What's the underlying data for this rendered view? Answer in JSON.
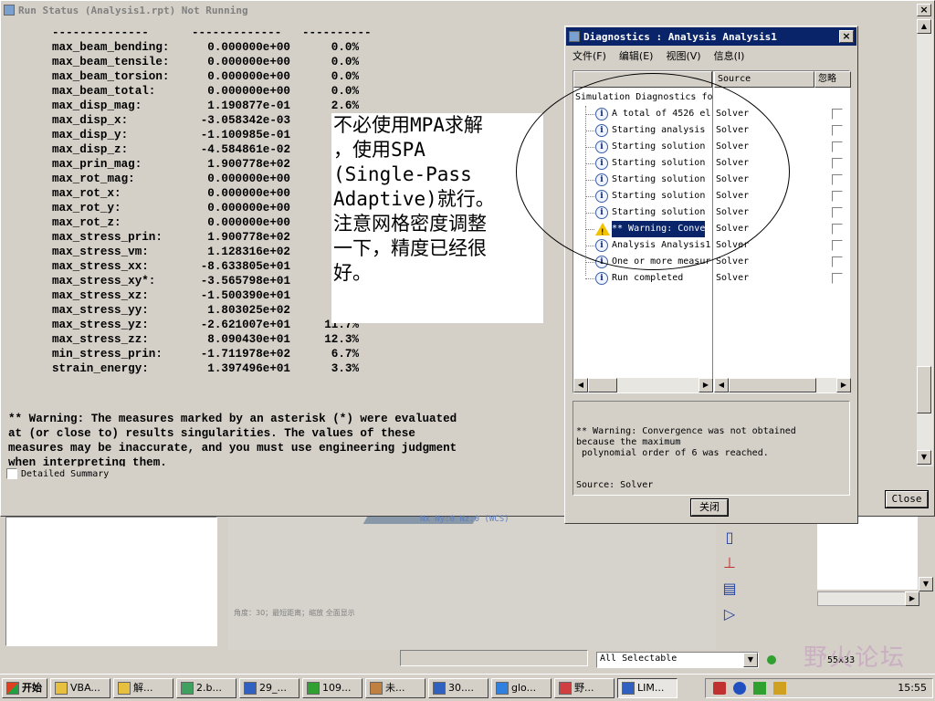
{
  "run_status": {
    "title": "Run Status (Analysis1.rpt) Not Running",
    "separator": [
      "--------------",
      "-------------",
      "----------"
    ],
    "rows": [
      {
        "name": "max_beam_bending:",
        "value": "0.000000e+00",
        "pct": "0.0%"
      },
      {
        "name": "max_beam_tensile:",
        "value": "0.000000e+00",
        "pct": "0.0%"
      },
      {
        "name": "max_beam_torsion:",
        "value": "0.000000e+00",
        "pct": "0.0%"
      },
      {
        "name": "max_beam_total:",
        "value": "0.000000e+00",
        "pct": "0.0%"
      },
      {
        "name": "max_disp_mag:",
        "value": "1.190877e-01",
        "pct": "2.6%"
      },
      {
        "name": "max_disp_x:",
        "value": "-3.058342e-03",
        "pct": "3"
      },
      {
        "name": "max_disp_y:",
        "value": "-1.100985e-01",
        "pct": "2"
      },
      {
        "name": "max_disp_z:",
        "value": "-4.584861e-02",
        "pct": "3"
      },
      {
        "name": "max_prin_mag:",
        "value": "1.900778e+02",
        "pct": "1("
      },
      {
        "name": "max_rot_mag:",
        "value": "0.000000e+00",
        "pct": "0"
      },
      {
        "name": "max_rot_x:",
        "value": "0.000000e+00",
        "pct": "0"
      },
      {
        "name": "max_rot_y:",
        "value": "0.000000e+00",
        "pct": "0"
      },
      {
        "name": "max_rot_z:",
        "value": "0.000000e+00",
        "pct": "0"
      },
      {
        "name": "max_stress_prin:",
        "value": "1.900778e+02",
        "pct": "1("
      },
      {
        "name": "max_stress_vm:",
        "value": "1.128316e+02",
        "pct": "4"
      },
      {
        "name": "max_stress_xx:",
        "value": "-8.633805e+01",
        "pct": "2"
      },
      {
        "name": "max_stress_xy*:",
        "value": "-3.565798e+01",
        "pct": "8"
      },
      {
        "name": "max_stress_xz:",
        "value": "-1.500390e+01",
        "pct": "1"
      },
      {
        "name": "max_stress_yy:",
        "value": "1.803025e+02",
        "pct": "1("
      },
      {
        "name": "max_stress_yz:",
        "value": "-2.621007e+01",
        "pct": "11.7%"
      },
      {
        "name": "max_stress_zz:",
        "value": "8.090430e+01",
        "pct": "12.3%"
      },
      {
        "name": "min_stress_prin:",
        "value": "-1.711978e+02",
        "pct": "6.7%"
      },
      {
        "name": "strain_energy:",
        "value": "1.397496e+01",
        "pct": "3.3%"
      }
    ],
    "warning_text": "** Warning: The measures marked by an asterisk (*) were evaluated\nat (or close to) results singularities. The values of these\nmeasures may be inaccurate, and you must use engineering judgment\nwhen interpreting them.",
    "detailed_summary_label": "Detailed Summary",
    "close_label": "Close"
  },
  "diagnostics": {
    "title": "Diagnostics : Analysis Analysis1",
    "close_glyph": "×",
    "menu": [
      "文件(F)",
      "编辑(E)",
      "视图(V)",
      "信息(I)"
    ],
    "columns": {
      "source": "Source",
      "ignore": "忽略"
    },
    "root": "Simulation Diagnostics fo",
    "items": [
      {
        "text": "A total of 4526 el",
        "source": "Solver",
        "kind": "info"
      },
      {
        "text": "Starting analysis",
        "source": "Solver",
        "kind": "info"
      },
      {
        "text": "Starting solution",
        "source": "Solver",
        "kind": "info"
      },
      {
        "text": "Starting solution",
        "source": "Solver",
        "kind": "info"
      },
      {
        "text": "Starting solution",
        "source": "Solver",
        "kind": "info"
      },
      {
        "text": "Starting solution",
        "source": "Solver",
        "kind": "info"
      },
      {
        "text": "Starting solution",
        "source": "Solver",
        "kind": "info"
      },
      {
        "text": "** Warning: Conve",
        "source": "Solver",
        "kind": "warning"
      },
      {
        "text": "Analysis Analysis1",
        "source": "Solver",
        "kind": "info"
      },
      {
        "text": "One or more measur",
        "source": "Solver",
        "kind": "info"
      },
      {
        "text": "Run completed",
        "source": "Solver",
        "kind": "info"
      }
    ],
    "message": "** Warning: Convergence was not obtained\nbecause the maximum\n polynomial order of 6 was reached.",
    "message_source": "Source: Solver",
    "close_button": "关闭"
  },
  "annotation": {
    "text": "不必使用MPA求解\n，使用SPA\n(Single-Pass\nAdaptive)就行。\n注意网格密度调整\n一下，精度已经很\n好。"
  },
  "app": {
    "graphics_label": "Nx Ny:0 Nz:0 (WCS)",
    "graphics_status": "角度：30；最短距离；缩放 全面显示",
    "selection_filter": "All Selectable",
    "size_readout": "55x33"
  },
  "taskbar": {
    "start": "开始",
    "buttons": [
      "VBA...",
      "解...",
      "2.b...",
      "29_...",
      "109...",
      "未...",
      "30....",
      "glo...",
      "野...",
      "LIM..."
    ],
    "active_index": 9,
    "clock": "15:55"
  },
  "watermark": "野火论坛",
  "colors": {
    "title_active": "#0a246a",
    "face": "#d4d0c8",
    "warning": "#f2c200"
  }
}
